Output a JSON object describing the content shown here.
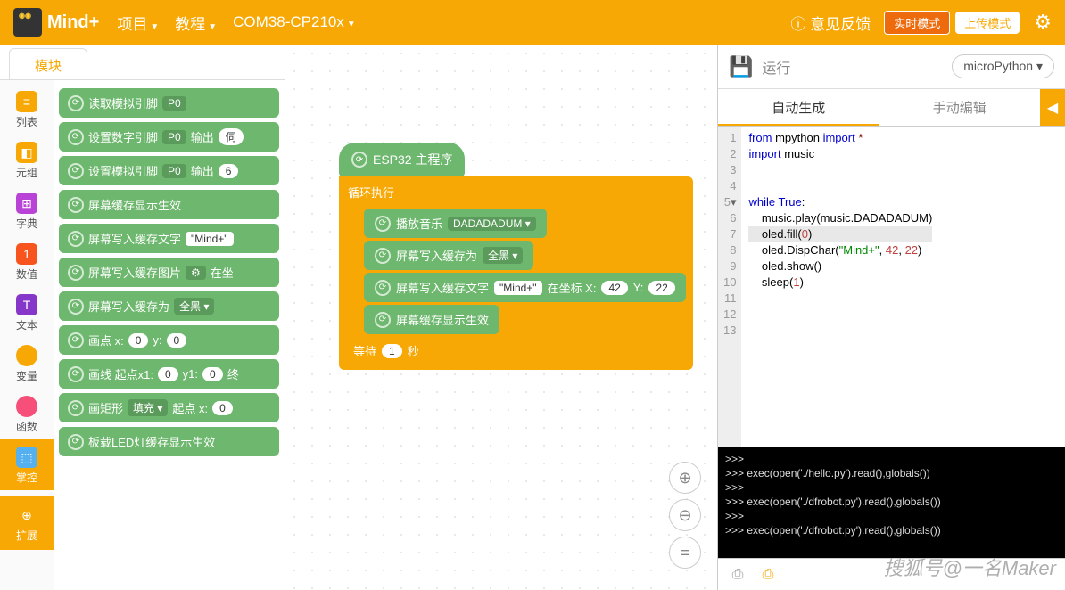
{
  "header": {
    "logo": "Mind+",
    "menu_project": "项目",
    "menu_tutorial": "教程",
    "port": "COM38-CP210x",
    "feedback": "意见反馈",
    "mode_realtime": "实时模式",
    "mode_upload": "上传模式"
  },
  "left": {
    "tab_blocks": "模块",
    "categories": {
      "list": "列表",
      "tuple": "元组",
      "dict": "字典",
      "num": "数值",
      "text": "文本",
      "var": "变量",
      "func": "函数",
      "ctrl": "掌控",
      "ext": "扩展"
    },
    "blocks": {
      "b0": "读取模拟引脚",
      "b0_p": "P0",
      "b1": "设置数字引脚",
      "b1_p": "P0",
      "b1_out": "输出",
      "b1_v": "伺",
      "b2": "设置模拟引脚",
      "b2_p": "P0",
      "b2_out": "输出",
      "b2_v": "6",
      "b3": "屏幕缓存显示生效",
      "b4": "屏幕写入缓存文字",
      "b4_s": "\"Mind+\"",
      "b5": "屏幕写入缓存图片",
      "b5_at": "在坐",
      "b6": "屏幕写入缓存为",
      "b6_v": "全黑",
      "b7": "画点 x:",
      "b7_x": "0",
      "b7_yl": "y:",
      "b7_y": "0",
      "b8": "画线 起点x1:",
      "b8_x": "0",
      "b8_yl": "y1:",
      "b8_y": "0",
      "b8_e": "终",
      "b9": "画矩形",
      "b9_f": "填充",
      "b9_s": "起点 x:",
      "b9_x": "0",
      "b10": "板载LED灯缓存显示生效"
    }
  },
  "canvas": {
    "hat": "ESP32 主程序",
    "loop": "循环执行",
    "c1": "播放音乐",
    "c1_v": "DADADADUM",
    "c2": "屏幕写入缓存为",
    "c2_v": "全黑",
    "c3": "屏幕写入缓存文字",
    "c3_s": "\"Mind+\"",
    "c3_at": "在坐标 X:",
    "c3_x": "42",
    "c3_yl": "Y:",
    "c3_y": "22",
    "c4": "屏幕缓存显示生效",
    "wait": "等待",
    "wait_v": "1",
    "wait_u": "秒"
  },
  "right": {
    "run": "运行",
    "lang": "microPython",
    "tab_auto": "自动生成",
    "tab_manual": "手动编辑"
  },
  "code": {
    "l1a": "from",
    "l1b": "mpython",
    "l1c": "import",
    "l1d": "*",
    "l2a": "import",
    "l2b": "music",
    "l5a": "while",
    "l5b": "True",
    "l5c": ":",
    "l6": "    music.play(music.DADADADUM)",
    "l7a": "    oled.fill(",
    "l7b": "0",
    "l7c": ")",
    "l8a": "    oled.DispChar(",
    "l8b": "\"Mind+\"",
    "l8c": ", ",
    "l8d": "42",
    "l8e": ", ",
    "l8f": "22",
    "l8g": ")",
    "l9": "    oled.show()",
    "l10a": "    sleep(",
    "l10b": "1",
    "l10c": ")"
  },
  "console": {
    "l1": ">>>",
    "l2": ">>> exec(open('./hello.py').read(),globals())",
    "l3": ">>>",
    "l4": ">>> exec(open('./dfrobot.py').read(),globals())",
    "l5": ">>>",
    "l6": ">>> exec(open('./dfrobot.py').read(),globals())"
  },
  "watermark": "搜狐号@一名Maker"
}
